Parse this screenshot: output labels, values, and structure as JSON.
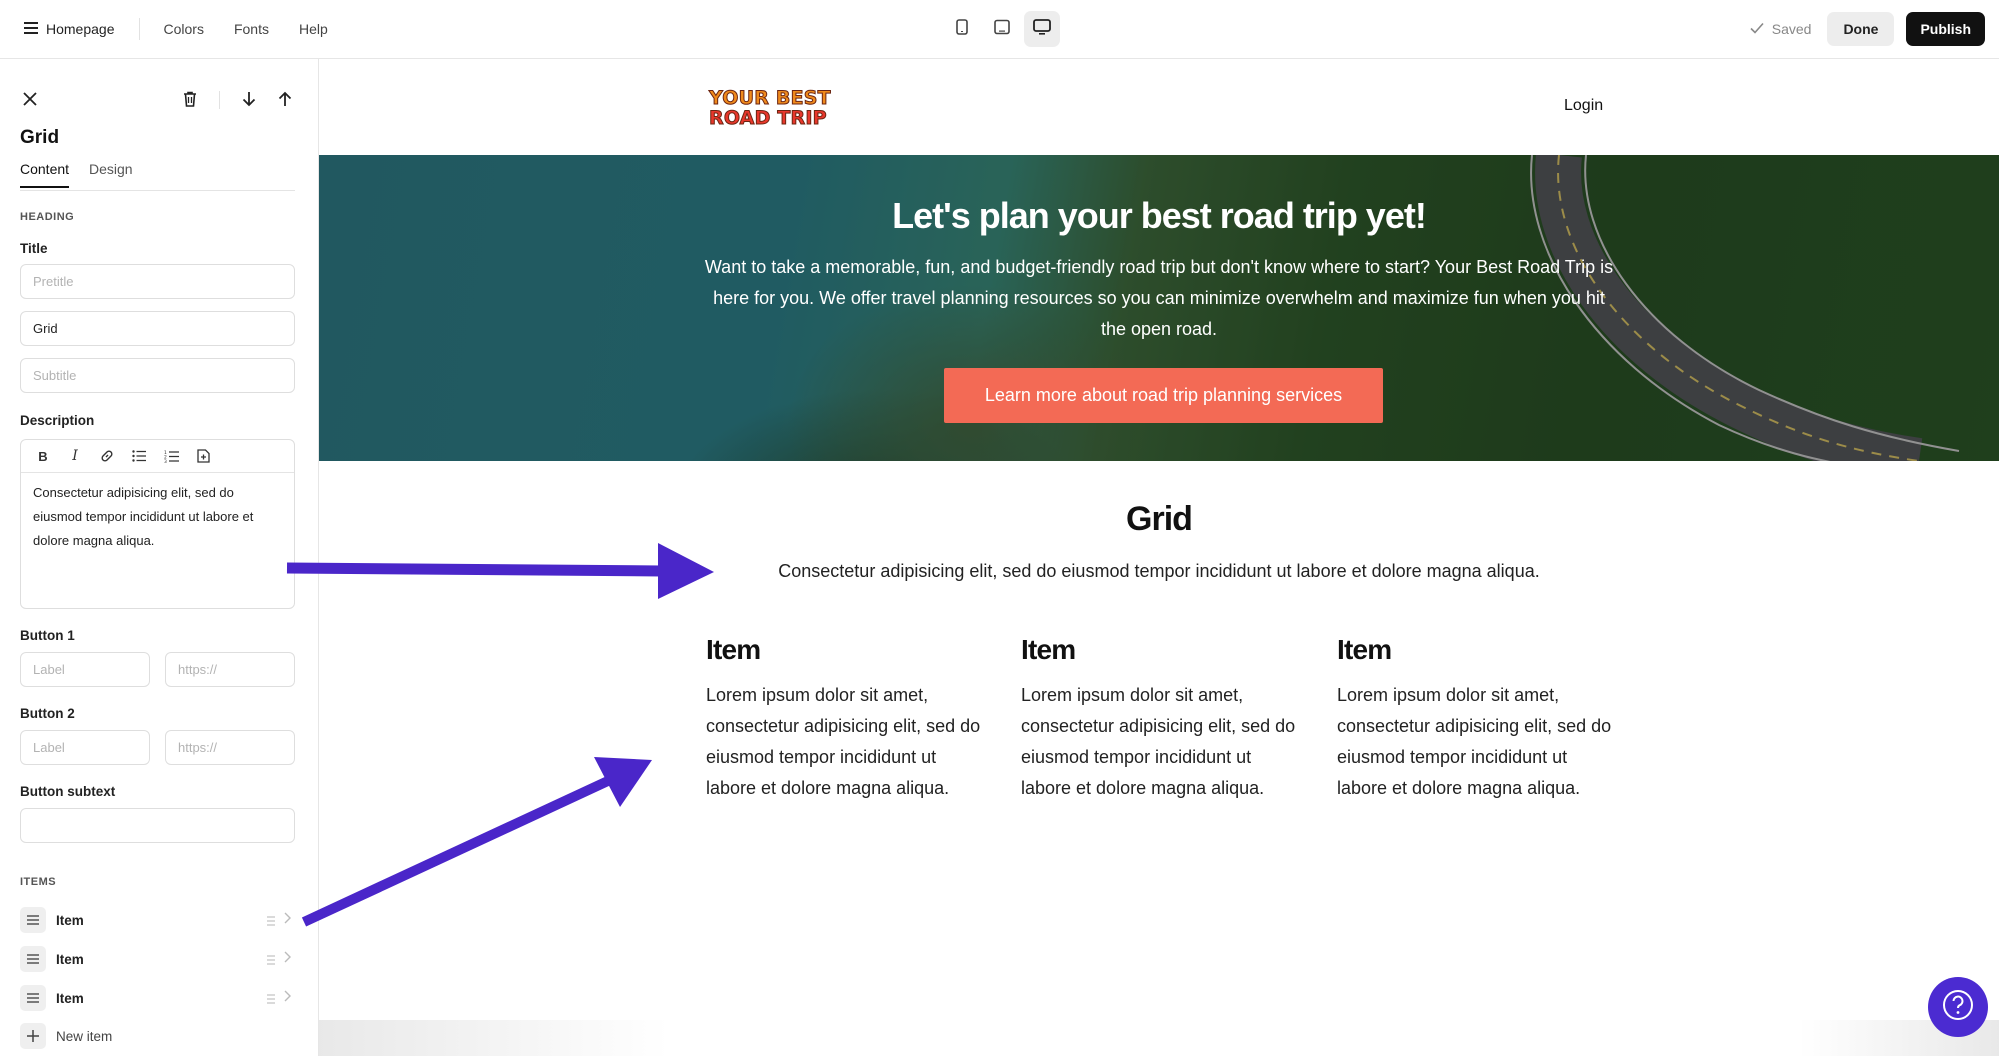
{
  "topbar": {
    "page_name": "Homepage",
    "links": [
      "Colors",
      "Fonts",
      "Help"
    ],
    "saved_label": "Saved",
    "done_label": "Done",
    "publish_label": "Publish"
  },
  "sidebar": {
    "block_title": "Grid",
    "tabs": [
      "Content",
      "Design"
    ],
    "heading_section": "HEADING",
    "title_label": "Title",
    "pretitle_placeholder": "Pretitle",
    "title_value": "Grid",
    "subtitle_placeholder": "Subtitle",
    "description_label": "Description",
    "description_value": "Consectetur adipisicing elit, sed do eiusmod tempor incididunt ut labore et dolore magna aliqua.",
    "button1_label": "Button 1",
    "button2_label": "Button 2",
    "label_placeholder": "Label",
    "url_placeholder": "https://",
    "button_subtext_label": "Button subtext",
    "items_section": "ITEMS",
    "items": [
      "Item",
      "Item",
      "Item"
    ],
    "new_item_label": "New item"
  },
  "site": {
    "logo_line1": "YOUR BEST",
    "logo_line2": "ROAD TRIP",
    "login": "Login",
    "hero_title": "Let's plan your best road trip yet!",
    "hero_text": "Want to take a memorable, fun, and budget-friendly road trip but don't know where to start? Your Best Road Trip is here for you. We offer travel planning resources so you can minimize overwhelm and maximize fun when you hit the open road.",
    "hero_button": "Learn more about road trip planning services",
    "grid_title": "Grid",
    "grid_description": "Consectetur adipisicing elit, sed do eiusmod tempor incididunt ut labore et dolore magna aliqua.",
    "grid_items": [
      {
        "title": "Item",
        "text": "Lorem ipsum dolor sit amet, consectetur adipisicing elit, sed do eiusmod tempor incididunt ut labore et dolore magna aliqua."
      },
      {
        "title": "Item",
        "text": "Lorem ipsum dolor sit amet, consectetur adipisicing elit, sed do eiusmod tempor incididunt ut labore et dolore magna aliqua."
      },
      {
        "title": "Item",
        "text": "Lorem ipsum dolor sit amet, consectetur adipisicing elit, sed do eiusmod tempor incididunt ut labore et dolore magna aliqua."
      }
    ]
  },
  "colors": {
    "accent_button": "#f36a55",
    "annotation_arrow": "#4a26c9",
    "help_button": "#4b2bd1"
  }
}
